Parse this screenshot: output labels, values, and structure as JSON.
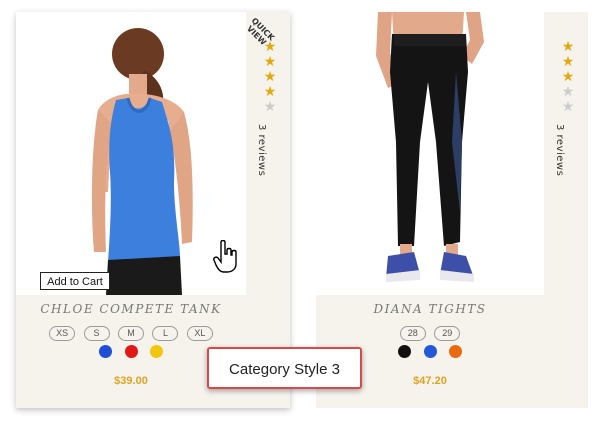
{
  "products": [
    {
      "name": "CHLOE COMPETE TANK",
      "price": "$39.00",
      "rating": 4,
      "reviews": "3 reviews",
      "quick_view": "QUICK\nVIEW",
      "sizes": [
        "XS",
        "S",
        "M",
        "L",
        "XL"
      ],
      "colors": [
        "#1e4fd6",
        "#e01818",
        "#f2c60c"
      ],
      "add_to_cart": "Add to Cart"
    },
    {
      "name": "DIANA TIGHTS",
      "price": "$47.20",
      "rating": 3,
      "reviews": "3 reviews",
      "sizes": [
        "28",
        "29"
      ],
      "colors": [
        "#111111",
        "#2258d8",
        "#ea6a10"
      ]
    }
  ],
  "callout": {
    "text": "Category Style 3"
  },
  "icons": {
    "star": "star-icon",
    "cursor": "hand-pointer-icon"
  },
  "accent": {
    "price": "#dfa322",
    "star": "#e2a90d",
    "callout_border": "#d64a4a"
  }
}
